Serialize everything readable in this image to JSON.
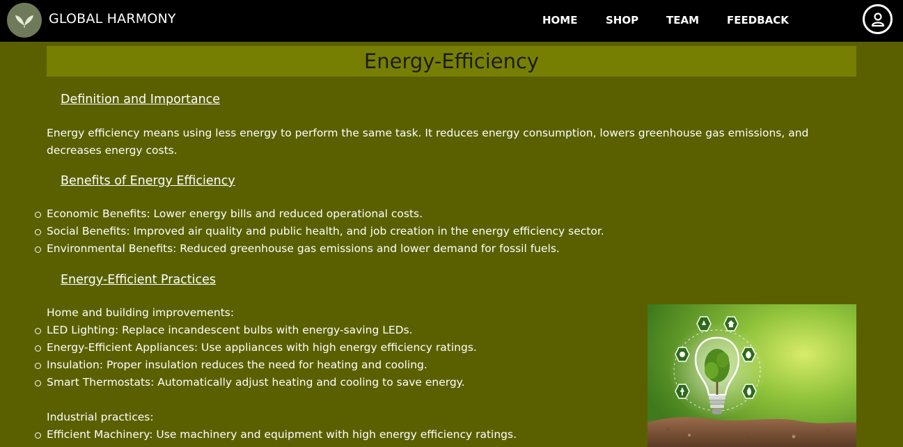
{
  "nav": {
    "brand": "GLOBAL HARMONY",
    "links": [
      "HOME",
      "SHOP",
      "TEAM",
      "FEEDBACK"
    ],
    "user_icon": "user-icon",
    "logo_icon": "leaf-icon"
  },
  "page": {
    "title": "Energy-Efficiency"
  },
  "sections": {
    "definition": {
      "heading": "Definition and Importance",
      "text": "Energy efficiency means using less energy to perform the same task. It reduces energy consumption, lowers greenhouse gas emissions, and decreases energy costs."
    },
    "benefits": {
      "heading": "Benefits of Energy Efficiency",
      "items": [
        "Economic Benefits: Lower energy bills and reduced operational costs.",
        "Social Benefits: Improved air quality and public health, and job creation in the energy efficiency sector.",
        "Environmental Benefits: Reduced greenhouse gas emissions and lower demand for fossil fuels."
      ]
    },
    "practices": {
      "heading": "Energy-Efficient Practices",
      "home_label": "Home and building improvements:",
      "home_items": [
        "LED Lighting: Replace incandescent bulbs with energy-saving LEDs.",
        "Energy-Efficient Appliances: Use appliances with high energy efficiency ratings.",
        "Insulation: Proper insulation reduces the need for heating and cooling.",
        "Smart Thermostats: Automatically adjust heating and cooling to save energy."
      ],
      "industrial_label": "Industrial practices:",
      "industrial_items": [
        "Efficient Machinery: Use machinery and equipment with high energy efficiency ratings."
      ]
    }
  },
  "colors": {
    "navbar": "#000000",
    "background": "#5a6000",
    "title_bar": "#777f02",
    "text": "#ffffff"
  }
}
